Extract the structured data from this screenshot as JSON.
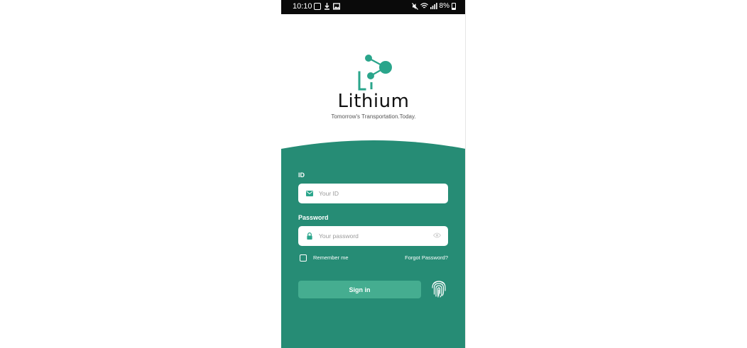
{
  "status_bar": {
    "time": "10:10",
    "battery": "8%"
  },
  "brand": {
    "symbol": "Li",
    "name": "Lithium",
    "tagline": "Tomorrow's Transportation.Today."
  },
  "login": {
    "id_label": "ID",
    "id_placeholder": "Your ID",
    "password_label": "Password",
    "password_placeholder": "Your password",
    "remember_label": "Remember me",
    "forgot_label": "Forgot Password?",
    "signin_label": "Sign in"
  },
  "colors": {
    "panel": "#268c75",
    "button": "#45ad90",
    "accent": "#2aa58b"
  },
  "icons": {
    "id_field": "mail-icon",
    "password_field": "lock-icon",
    "password_toggle": "eye-icon",
    "biometric": "fingerprint-icon"
  }
}
